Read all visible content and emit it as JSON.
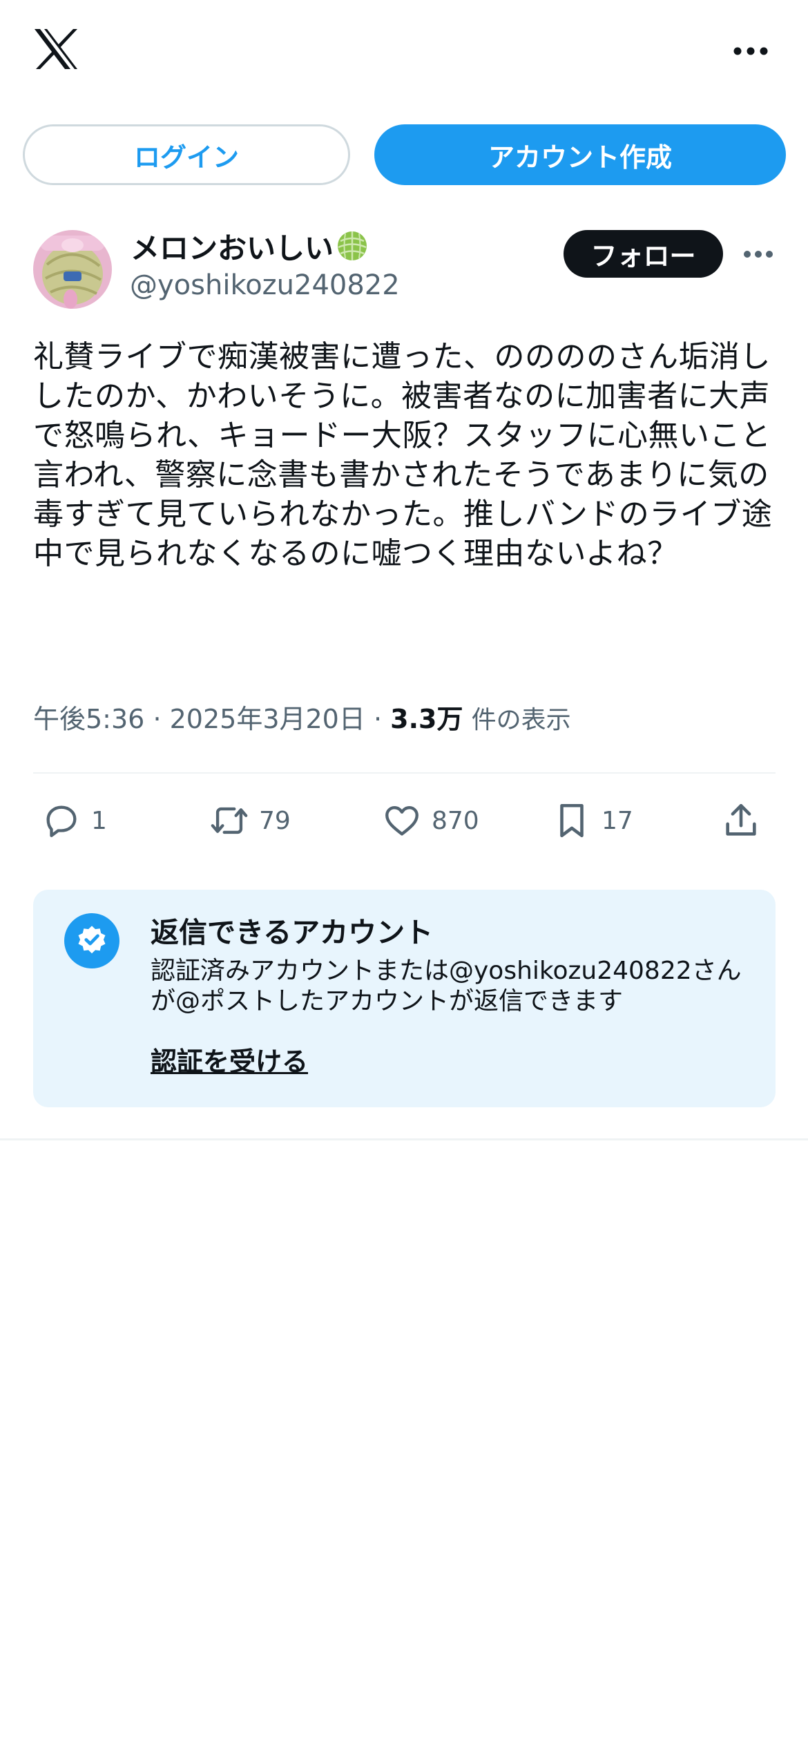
{
  "header": {
    "logo_icon": "x-logo-icon",
    "more_icon": "more-horizontal-icon"
  },
  "auth": {
    "login_label": "ログイン",
    "signup_label": "アカウント作成"
  },
  "post": {
    "author": {
      "name": "メロンおいしい",
      "name_emoji_icon": "melon-icon",
      "handle": "@yoshikozu240822"
    },
    "follow_label": "フォロー",
    "text": "礼賛ライブで痴漢被害に遭った、ののののさん垢消ししたのか、かわいそうに。被害者なのに加害者に大声で怒鳴られ、キョードー大阪？スタッフに心無いこと言われ、警察に念書も書かされたそうであまりに気の毒すぎて見ていられなかった。推しバンドのライブ途中で見られなくなるのに嘘つく理由ないよね？",
    "meta": {
      "time": "午後5:36",
      "separator": "·",
      "date": "2025年3月20日",
      "views_count": "3.3万",
      "views_label": "件の表示"
    },
    "actions": {
      "replies": "1",
      "reposts": "79",
      "likes": "870",
      "bookmarks": "17"
    }
  },
  "reply_restriction": {
    "title": "返信できるアカウント",
    "description": "認証済みアカウントまたは@yoshikozu240822さんが@ポストしたアカウントが返信できます",
    "link_label": "認証を受ける"
  },
  "colors": {
    "accent": "#1d9bf0",
    "text": "#0f1419",
    "muted": "#536471",
    "info_bg": "#e8f5fd",
    "divider": "#eff3f4"
  }
}
